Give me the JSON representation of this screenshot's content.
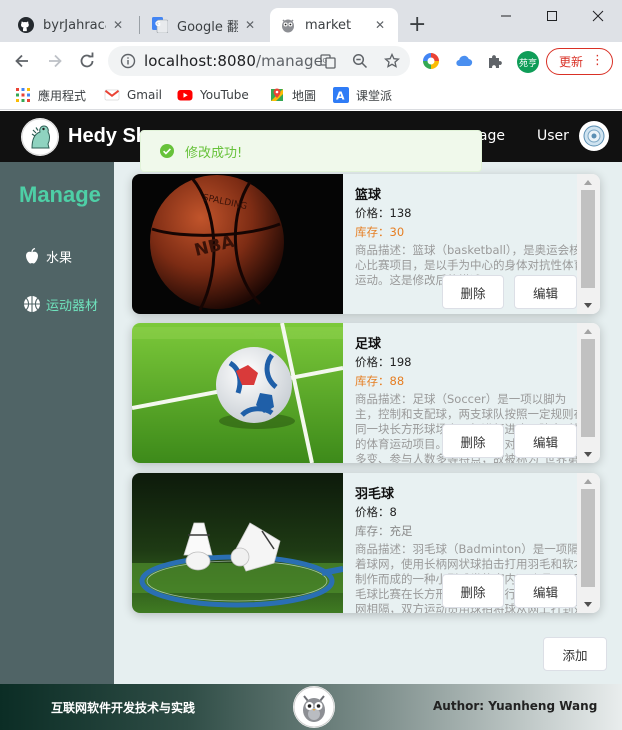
{
  "browser": {
    "tabs": [
      {
        "title": "byrJahracal",
        "icon": "github-icon"
      },
      {
        "title": "Google 翻訳",
        "icon": "google-translate-icon"
      },
      {
        "title": "market",
        "icon": "owl-favicon"
      }
    ],
    "url_host": "localhost:8080",
    "url_path": "/manage",
    "profile_badge": "苑亨",
    "update_button": "更新",
    "bookmarks": [
      {
        "label": "應用程式",
        "icon": "apps-grid-icon"
      },
      {
        "label": "Gmail",
        "icon": "gmail-icon"
      },
      {
        "label": "YouTube",
        "icon": "youtube-icon"
      },
      {
        "label": "地圖",
        "icon": "maps-icon"
      },
      {
        "label": "课堂派",
        "icon": "ketangpai-icon"
      }
    ]
  },
  "header": {
    "brand": "Hedy Sh",
    "menu_manage": "nage",
    "menu_user": "User"
  },
  "toast": {
    "message": "修改成功!",
    "color": "#67c23a"
  },
  "sidebar": {
    "title": "Manage",
    "items": [
      {
        "label": "水果",
        "icon": "apple-icon"
      },
      {
        "label": "运动器材",
        "icon": "basketball-icon"
      }
    ]
  },
  "products": [
    {
      "name": "篮球",
      "price": "价格：138",
      "stock": "库存：30",
      "desc": "商品描述：篮球（basketball），是奥运会核心比赛项目，是以手为中心的身体对抗性体育运动。这是修改后的描述",
      "delete_label": "删除",
      "edit_label": "编辑"
    },
    {
      "name": "足球",
      "price": "价格：198",
      "stock": "库存：88",
      "desc": "商品描述：足球（Soccer）是一项以脚为主，控制和支配球，两支球队按照一定规则在同一块长方形球场上互相进行进攻、防守对抗的体育运动项目。因足球运动对抗性强、战术多变、参与人数多等特点，故被称为\"世界第一运动\"",
      "delete_label": "删除",
      "edit_label": "编辑"
    },
    {
      "name": "羽毛球",
      "price": "价格：8",
      "stock": "库存：充足",
      "desc": "商品描述：羽毛球（Badminton）是一项隔着球网，使用长柄网状球拍击打用羽毛和软木制作而成的一种小型球类的室内运动项目。羽毛球比赛在长方形的场地上进行，场地中间有网相隔，双方运动员用球拍将球从网上打到对方场地区域",
      "delete_label": "删除",
      "edit_label": "编辑"
    }
  ],
  "add_button": "添加",
  "footer": {
    "left_text": "互联网软件开发技术与实践",
    "right_text": "Author: Yuanheng Wang"
  }
}
